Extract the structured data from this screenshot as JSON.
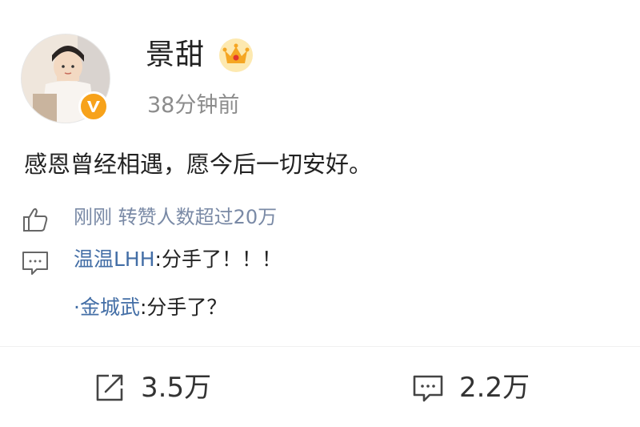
{
  "post": {
    "username": "景甜",
    "timestamp": "38分钟前",
    "content": "感恩曾经相遇，愿今后一切安好。"
  },
  "interactions": {
    "like_text": "刚刚 转赞人数超过20万",
    "comments": [
      {
        "user": "温温LHH",
        "separator": ":",
        "text": "分手了！！！"
      },
      {
        "user": "·金城武",
        "separator": ":",
        "text": "分手了？"
      }
    ]
  },
  "footer": {
    "share_count": "3.5万",
    "comment_count": "2.2万"
  },
  "colors": {
    "link_blue": "#436ea6",
    "verified_badge": "#f7a21a",
    "crown_gold": "#f5c542"
  },
  "icons": {
    "verified": "verified-v-icon",
    "crown": "vip-crown-icon",
    "like": "thumbs-up-icon",
    "comment": "comment-bubble-icon",
    "share": "share-icon"
  }
}
